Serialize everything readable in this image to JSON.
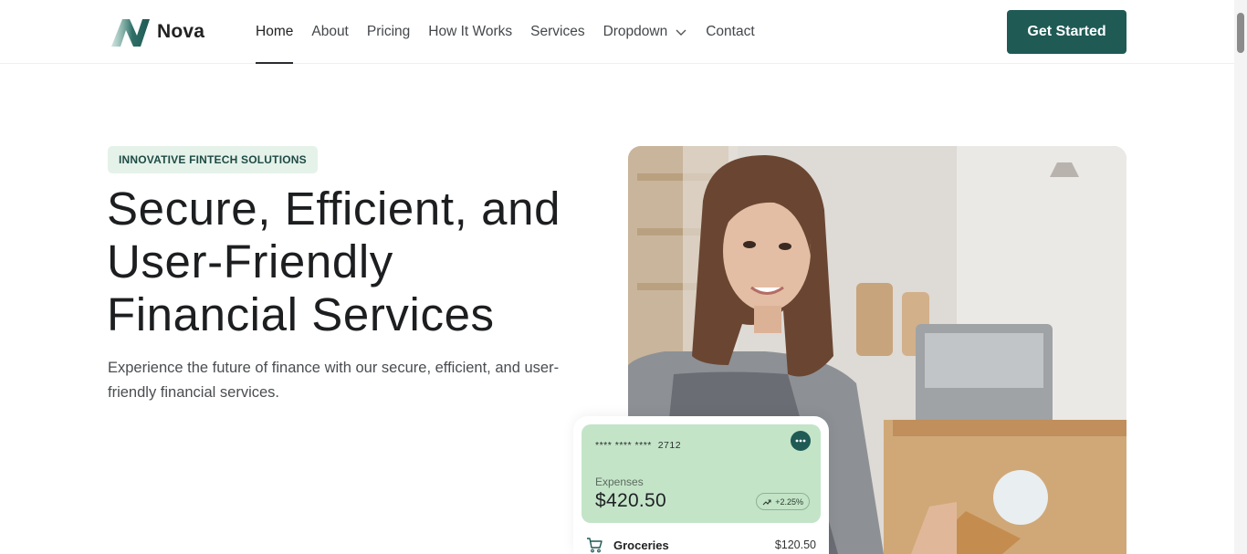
{
  "brand": {
    "name": "Nova",
    "accent_color": "#1f5a55"
  },
  "nav": {
    "items": [
      {
        "label": "Home",
        "active": true
      },
      {
        "label": "About"
      },
      {
        "label": "Pricing"
      },
      {
        "label": "How It Works"
      },
      {
        "label": "Services"
      },
      {
        "label": "Dropdown"
      },
      {
        "label": "Contact"
      }
    ],
    "cta_label": "Get Started"
  },
  "hero": {
    "badge": "INNOVATIVE FINTECH SOLUTIONS",
    "title_line1": "Secure, Efficient, and",
    "title_line2": "User-Friendly",
    "title_line3": "Financial Services",
    "subtitle": "Experience the future of finance with our secure, efficient, and user-friendly financial services."
  },
  "card": {
    "number_masked": "**** **** ****",
    "number_last4": "2712",
    "label": "Expenses",
    "amount": "$420.50",
    "change": "+2.25%",
    "expense_item": {
      "name": "Groceries",
      "amount": "$120.50",
      "icon": "cart-icon"
    }
  }
}
